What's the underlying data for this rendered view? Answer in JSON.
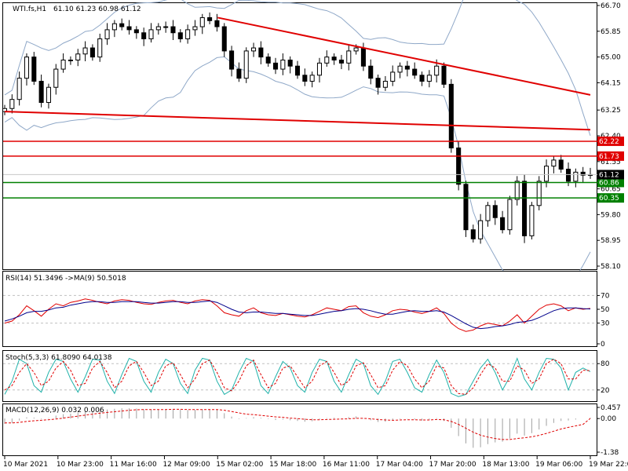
{
  "chart_data": [
    {
      "type": "candlestick",
      "panel": "price",
      "title": "WTI.fs,H1",
      "ohlc_header": "61.10 61.23 60.98 61.12",
      "ylim": [
        58.1,
        66.7
      ],
      "y_ticks": [
        "66.70",
        "65.85",
        "65.00",
        "64.15",
        "63.25",
        "62.40",
        "61.55",
        "60.65",
        "59.80",
        "58.95",
        "58.10"
      ],
      "current_price": "61.12",
      "support_lines": [
        {
          "value": 60.86,
          "label": "60.86",
          "color": "#008000"
        },
        {
          "value": 60.35,
          "label": "60.35",
          "color": "#008000"
        }
      ],
      "resistance_lines": [
        {
          "value": 61.73,
          "label": "61.73",
          "color": "#e00000"
        },
        {
          "value": 62.22,
          "label": "62.22",
          "color": "#e00000"
        }
      ],
      "trend_lines": [
        {
          "from": {
            "x": "10 Mar 2021",
            "y": 63.2
          },
          "to": {
            "x": "19 Mar 22:00",
            "y": 62.6
          },
          "color": "#e00000"
        },
        {
          "from": {
            "x": "15 Mar 02:00",
            "y": 66.3
          },
          "to": {
            "x": "19 Mar 22:00",
            "y": 63.75
          },
          "color": "#e00000"
        }
      ],
      "bollinger": "bands shown",
      "candles_close_path": [
        63.3,
        63.6,
        64.3,
        65.0,
        64.2,
        63.5,
        64.0,
        64.6,
        64.9,
        64.9,
        65.1,
        65.3,
        65.0,
        65.6,
        65.9,
        66.1,
        66.0,
        65.9,
        65.8,
        65.6,
        65.9,
        66.0,
        66.0,
        65.8,
        65.6,
        65.9,
        66.0,
        66.3,
        66.2,
        66.0,
        65.2,
        64.6,
        64.3,
        65.2,
        65.3,
        65.0,
        64.8,
        64.6,
        64.9,
        64.7,
        64.4,
        64.2,
        64.4,
        64.8,
        65.0,
        64.9,
        64.8,
        65.2,
        65.3,
        64.7,
        64.3,
        64.0,
        64.2,
        64.5,
        64.7,
        64.6,
        64.4,
        64.2,
        64.4,
        64.7,
        64.1,
        62.0,
        60.8,
        59.3,
        59.0,
        59.6,
        60.1,
        59.7,
        59.3,
        60.3,
        60.9,
        59.1,
        60.1,
        60.9,
        61.4,
        61.6,
        61.3,
        60.9,
        61.2,
        61.1,
        61.12
      ]
    },
    {
      "type": "line",
      "panel": "rsi",
      "title": "RSI(14) 51.3496 ->MA(9) 50.5018",
      "ylim": [
        0,
        100
      ],
      "y_ticks": [
        "70",
        "50",
        "30",
        "0"
      ],
      "levels": [
        70,
        30
      ],
      "series": [
        {
          "color": "#e00000",
          "values": [
            30,
            33,
            42,
            55,
            48,
            40,
            50,
            58,
            55,
            60,
            62,
            65,
            63,
            60,
            58,
            62,
            64,
            63,
            60,
            58,
            57,
            60,
            62,
            63,
            60,
            58,
            62,
            64,
            63,
            55,
            45,
            42,
            40,
            48,
            52,
            45,
            42,
            41,
            44,
            42,
            40,
            39,
            42,
            47,
            52,
            50,
            48,
            54,
            55,
            45,
            40,
            38,
            42,
            48,
            50,
            49,
            46,
            44,
            47,
            52,
            44,
            30,
            22,
            18,
            20,
            26,
            30,
            28,
            26,
            33,
            42,
            30,
            40,
            50,
            56,
            58,
            55,
            48,
            52,
            50,
            51.3
          ]
        },
        {
          "color": "#00008b",
          "values": [
            33,
            36,
            40,
            45,
            47,
            47,
            49,
            52,
            53,
            56,
            58,
            60,
            61,
            61,
            60,
            60,
            61,
            61,
            61,
            60,
            59,
            59,
            60,
            61,
            61,
            60,
            60,
            61,
            62,
            60,
            55,
            50,
            46,
            45,
            46,
            46,
            45,
            44,
            44,
            43,
            42,
            41,
            41,
            43,
            45,
            47,
            48,
            50,
            51,
            50,
            48,
            45,
            43,
            43,
            45,
            47,
            48,
            47,
            47,
            48,
            46,
            41,
            35,
            29,
            24,
            22,
            23,
            25,
            26,
            28,
            31,
            32,
            34,
            38,
            43,
            48,
            51,
            52,
            52,
            51,
            50.5
          ]
        }
      ]
    },
    {
      "type": "line",
      "panel": "stochastic",
      "title": "Stoch(5,3,3) 61.8090 64.0138",
      "ylim": [
        0,
        100
      ],
      "y_ticks": [
        "80",
        "20"
      ],
      "levels": [
        80,
        20
      ],
      "series": [
        {
          "color": "#20b2aa",
          "values": [
            10,
            40,
            90,
            80,
            30,
            15,
            60,
            90,
            85,
            45,
            15,
            50,
            90,
            88,
            40,
            12,
            55,
            92,
            85,
            40,
            15,
            60,
            90,
            80,
            35,
            12,
            65,
            92,
            88,
            40,
            10,
            20,
            60,
            92,
            85,
            30,
            12,
            50,
            85,
            70,
            30,
            15,
            60,
            90,
            85,
            40,
            15,
            55,
            90,
            80,
            30,
            10,
            40,
            85,
            90,
            60,
            25,
            15,
            55,
            88,
            60,
            12,
            5,
            10,
            40,
            70,
            90,
            60,
            20,
            50,
            92,
            45,
            20,
            60,
            92,
            90,
            70,
            20,
            60,
            70,
            61.8
          ]
        },
        {
          "color": "#e00000",
          "values": [
            20,
            30,
            60,
            80,
            60,
            30,
            40,
            70,
            85,
            65,
            30,
            35,
            70,
            85,
            60,
            25,
            40,
            75,
            85,
            60,
            30,
            40,
            75,
            82,
            55,
            25,
            45,
            80,
            88,
            60,
            25,
            18,
            40,
            75,
            88,
            55,
            25,
            35,
            70,
            75,
            50,
            25,
            40,
            75,
            85,
            60,
            30,
            40,
            75,
            82,
            55,
            25,
            30,
            65,
            85,
            75,
            45,
            25,
            40,
            75,
            70,
            30,
            12,
            10,
            25,
            55,
            80,
            70,
            40,
            40,
            75,
            65,
            35,
            45,
            80,
            90,
            80,
            45,
            45,
            65,
            64.0
          ]
        }
      ]
    },
    {
      "type": "bar",
      "panel": "macd",
      "title": "MACD(12,26,9) 0.032 0.006",
      "ylim": [
        -1.38,
        0.457
      ],
      "y_ticks": [
        "0.457",
        "0.00",
        "-1.38"
      ],
      "histogram": [
        -0.22,
        -0.18,
        -0.08,
        0.05,
        0.04,
        -0.02,
        0.02,
        0.12,
        0.18,
        0.2,
        0.25,
        0.3,
        0.32,
        0.35,
        0.37,
        0.4,
        0.42,
        0.42,
        0.41,
        0.38,
        0.36,
        0.37,
        0.38,
        0.39,
        0.37,
        0.35,
        0.36,
        0.38,
        0.39,
        0.36,
        0.22,
        0.08,
        -0.02,
        0.02,
        0.06,
        0.03,
        -0.02,
        -0.06,
        -0.04,
        -0.07,
        -0.1,
        -0.13,
        -0.11,
        -0.04,
        0.02,
        0.03,
        0.01,
        0.06,
        0.09,
        0.01,
        -0.07,
        -0.14,
        -0.13,
        -0.08,
        -0.02,
        -0.01,
        -0.04,
        -0.08,
        -0.05,
        0.02,
        -0.1,
        -0.38,
        -0.72,
        -1.02,
        -1.2,
        -1.18,
        -1.05,
        -0.98,
        -0.95,
        -0.82,
        -0.62,
        -0.7,
        -0.6,
        -0.45,
        -0.3,
        -0.18,
        -0.1,
        -0.08,
        -0.04,
        0.0,
        0.032
      ],
      "signal": [
        -0.18,
        -0.18,
        -0.16,
        -0.12,
        -0.09,
        -0.07,
        -0.05,
        -0.02,
        0.02,
        0.06,
        0.1,
        0.14,
        0.18,
        0.22,
        0.25,
        0.28,
        0.31,
        0.34,
        0.36,
        0.37,
        0.37,
        0.37,
        0.37,
        0.38,
        0.38,
        0.37,
        0.37,
        0.37,
        0.37,
        0.37,
        0.34,
        0.29,
        0.23,
        0.18,
        0.16,
        0.13,
        0.1,
        0.07,
        0.05,
        0.02,
        0.0,
        -0.03,
        -0.05,
        -0.05,
        -0.04,
        -0.03,
        -0.02,
        -0.01,
        0.01,
        0.01,
        -0.01,
        -0.04,
        -0.06,
        -0.07,
        -0.06,
        -0.05,
        -0.05,
        -0.06,
        -0.06,
        -0.04,
        -0.05,
        -0.12,
        -0.24,
        -0.4,
        -0.56,
        -0.68,
        -0.76,
        -0.82,
        -0.86,
        -0.86,
        -0.82,
        -0.79,
        -0.75,
        -0.69,
        -0.61,
        -0.52,
        -0.43,
        -0.36,
        -0.3,
        -0.24,
        0.006
      ]
    }
  ],
  "x_axis_labels": [
    "10 Mar 2021",
    "10 Mar 23:00",
    "11 Mar 16:00",
    "12 Mar 09:00",
    "15 Mar 02:00",
    "15 Mar 18:00",
    "16 Mar 11:00",
    "17 Mar 04:00",
    "17 Mar 20:00",
    "18 Mar 13:00",
    "19 Mar 06:00",
    "19 Mar 22:00"
  ],
  "colors": {
    "bull": "#000000",
    "bear": "#000000",
    "band": "#8fa8c8",
    "grid": "#c0c0c0",
    "red_line": "#e00000",
    "green_line": "#008000",
    "price_tag": "#000000",
    "red_tag": "#e00000",
    "green_tag": "#008000"
  }
}
